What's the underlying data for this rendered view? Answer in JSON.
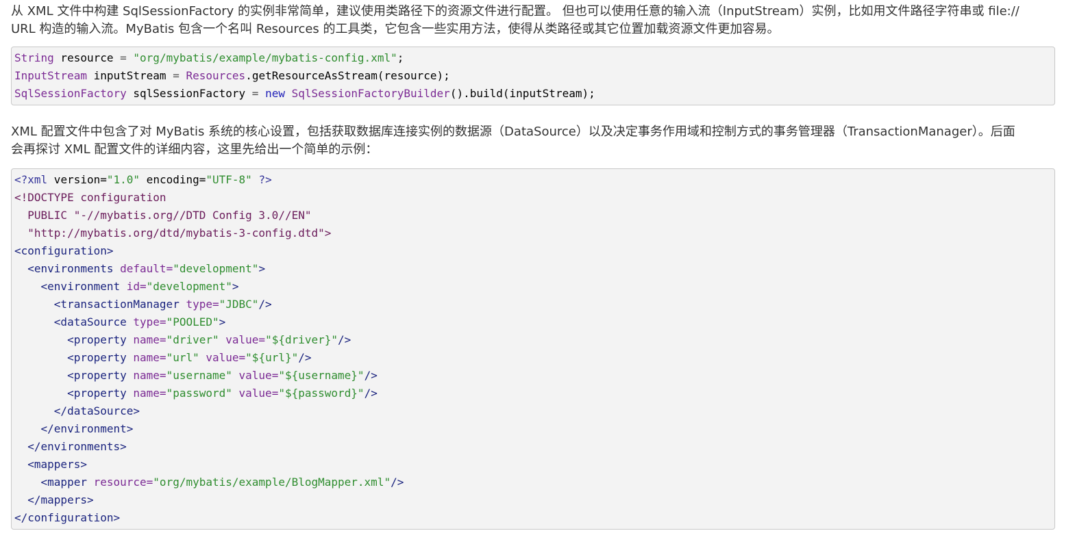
{
  "intro": {
    "line1": "从 XML 文件中构建 SqlSessionFactory 的实例非常简单，建议使用类路径下的资源文件进行配置。 但也可以使用任意的输入流（InputStream）实例，比如用文件路径字符串或 file://",
    "line2": "URL 构造的输入流。MyBatis 包含一个名叫 Resources 的工具类，它包含一些实用方法，使得从类路径或其它位置加载资源文件更加容易。"
  },
  "java_code": {
    "lines": [
      [
        {
          "t": "String",
          "c": "type"
        },
        {
          "t": " resource ",
          "c": "plain"
        },
        {
          "t": "=",
          "c": "op"
        },
        {
          "t": " ",
          "c": "plain"
        },
        {
          "t": "\"org/mybatis/example/mybatis-config.xml\"",
          "c": "str"
        },
        {
          "t": ";",
          "c": "plain"
        }
      ],
      [
        {
          "t": "InputStream",
          "c": "type"
        },
        {
          "t": " inputStream ",
          "c": "plain"
        },
        {
          "t": "=",
          "c": "op"
        },
        {
          "t": " ",
          "c": "plain"
        },
        {
          "t": "Resources",
          "c": "type"
        },
        {
          "t": ".getResourceAsStream(resource);",
          "c": "plain"
        }
      ],
      [
        {
          "t": "SqlSessionFactory",
          "c": "type"
        },
        {
          "t": " sqlSessionFactory ",
          "c": "plain"
        },
        {
          "t": "=",
          "c": "op"
        },
        {
          "t": " ",
          "c": "plain"
        },
        {
          "t": "new",
          "c": "kw"
        },
        {
          "t": " ",
          "c": "plain"
        },
        {
          "t": "SqlSessionFactoryBuilder",
          "c": "type"
        },
        {
          "t": "().build(inputStream);",
          "c": "plain"
        }
      ]
    ]
  },
  "description": {
    "line1": "XML 配置文件中包含了对 MyBatis 系统的核心设置，包括获取数据库连接实例的数据源（DataSource）以及决定事务作用域和控制方式的事务管理器（TransactionManager）。后面",
    "line2": "会再探讨 XML 配置文件的详细内容，这里先给出一个简单的示例："
  },
  "xml_code": {
    "lines": [
      [
        {
          "t": "<?xml",
          "c": "meta"
        },
        {
          "t": " version=",
          "c": "plain"
        },
        {
          "t": "\"1.0\"",
          "c": "str"
        },
        {
          "t": " encoding=",
          "c": "plain"
        },
        {
          "t": "\"UTF-8\"",
          "c": "str"
        },
        {
          "t": " ?>",
          "c": "meta"
        }
      ],
      [
        {
          "t": "<!DOCTYPE configuration",
          "c": "doc"
        }
      ],
      [
        {
          "t": "  PUBLIC \"-//mybatis.org//DTD Config 3.0//EN\"",
          "c": "doc"
        }
      ],
      [
        {
          "t": "  \"http://mybatis.org/dtd/mybatis-3-config.dtd\">",
          "c": "doc"
        }
      ],
      [
        {
          "t": "<configuration>",
          "c": "tag"
        }
      ],
      [
        {
          "t": "  <environments",
          "c": "tag"
        },
        {
          "t": " default=",
          "c": "attr"
        },
        {
          "t": "\"development\"",
          "c": "str"
        },
        {
          "t": ">",
          "c": "tag"
        }
      ],
      [
        {
          "t": "    <environment",
          "c": "tag"
        },
        {
          "t": " id=",
          "c": "attr"
        },
        {
          "t": "\"development\"",
          "c": "str"
        },
        {
          "t": ">",
          "c": "tag"
        }
      ],
      [
        {
          "t": "      <transactionManager",
          "c": "tag"
        },
        {
          "t": " type=",
          "c": "attr"
        },
        {
          "t": "\"JDBC\"",
          "c": "str"
        },
        {
          "t": "/>",
          "c": "tag"
        }
      ],
      [
        {
          "t": "      <dataSource",
          "c": "tag"
        },
        {
          "t": " type=",
          "c": "attr"
        },
        {
          "t": "\"POOLED\"",
          "c": "str"
        },
        {
          "t": ">",
          "c": "tag"
        }
      ],
      [
        {
          "t": "        <property",
          "c": "tag"
        },
        {
          "t": " name=",
          "c": "attr"
        },
        {
          "t": "\"driver\"",
          "c": "str"
        },
        {
          "t": " value=",
          "c": "attr"
        },
        {
          "t": "\"${driver}\"",
          "c": "str"
        },
        {
          "t": "/>",
          "c": "tag"
        }
      ],
      [
        {
          "t": "        <property",
          "c": "tag"
        },
        {
          "t": " name=",
          "c": "attr"
        },
        {
          "t": "\"url\"",
          "c": "str"
        },
        {
          "t": " value=",
          "c": "attr"
        },
        {
          "t": "\"${url}\"",
          "c": "str"
        },
        {
          "t": "/>",
          "c": "tag"
        }
      ],
      [
        {
          "t": "        <property",
          "c": "tag"
        },
        {
          "t": " name=",
          "c": "attr"
        },
        {
          "t": "\"username\"",
          "c": "str"
        },
        {
          "t": " value=",
          "c": "attr"
        },
        {
          "t": "\"${username}\"",
          "c": "str"
        },
        {
          "t": "/>",
          "c": "tag"
        }
      ],
      [
        {
          "t": "        <property",
          "c": "tag"
        },
        {
          "t": " name=",
          "c": "attr"
        },
        {
          "t": "\"password\"",
          "c": "str"
        },
        {
          "t": " value=",
          "c": "attr"
        },
        {
          "t": "\"${password}\"",
          "c": "str"
        },
        {
          "t": "/>",
          "c": "tag"
        }
      ],
      [
        {
          "t": "      </dataSource>",
          "c": "tag"
        }
      ],
      [
        {
          "t": "    </environment>",
          "c": "tag"
        }
      ],
      [
        {
          "t": "  </environments>",
          "c": "tag"
        }
      ],
      [
        {
          "t": "  <mappers>",
          "c": "tag"
        }
      ],
      [
        {
          "t": "    <mapper",
          "c": "tag"
        },
        {
          "t": " resource=",
          "c": "attr"
        },
        {
          "t": "\"org/mybatis/example/BlogMapper.xml\"",
          "c": "str"
        },
        {
          "t": "/>",
          "c": "tag"
        }
      ],
      [
        {
          "t": "  </mappers>",
          "c": "tag"
        }
      ],
      [
        {
          "t": "</configuration>",
          "c": "tag"
        }
      ]
    ]
  },
  "colors": {
    "code_background": "#f3f3f3",
    "code_border": "#c8c8c8",
    "text": "#333333",
    "type": "#7b2a94",
    "string": "#2f8d2f",
    "keyword": "#1f1fb8",
    "tag": "#1a237e"
  }
}
